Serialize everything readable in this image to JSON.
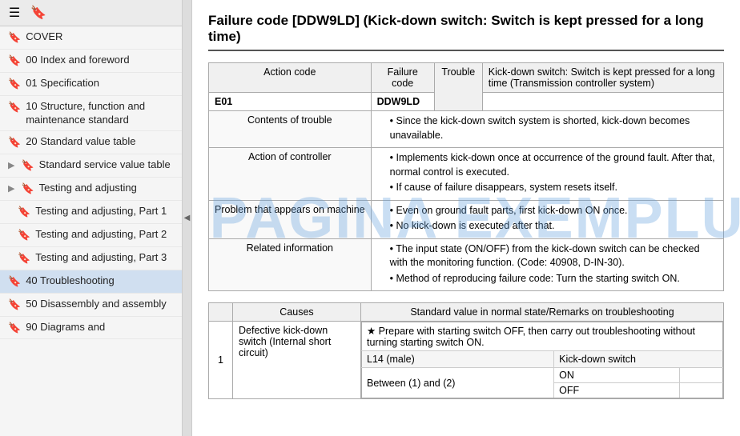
{
  "sidebar": {
    "toolbar": {
      "menu_icon": "☰",
      "bookmark_icon": "🔖"
    },
    "items": [
      {
        "id": "cover",
        "label": "COVER",
        "indent": false,
        "expandable": false,
        "active": false
      },
      {
        "id": "00-index",
        "label": "00 Index and foreword",
        "indent": false,
        "expandable": false,
        "active": false
      },
      {
        "id": "01-spec",
        "label": "01 Specification",
        "indent": false,
        "expandable": false,
        "active": false
      },
      {
        "id": "10-structure",
        "label": "10 Structure, function and maintenance standard",
        "indent": false,
        "expandable": false,
        "active": false
      },
      {
        "id": "20-standard",
        "label": "20 Standard value table",
        "indent": false,
        "expandable": false,
        "active": false
      },
      {
        "id": "standard-service",
        "label": "Standard service value table",
        "indent": false,
        "expandable": true,
        "active": false
      },
      {
        "id": "testing-adj",
        "label": "Testing and adjusting",
        "indent": false,
        "expandable": true,
        "active": false
      },
      {
        "id": "testing-adj-1",
        "label": "Testing and adjusting, Part 1",
        "indent": true,
        "expandable": false,
        "active": false
      },
      {
        "id": "testing-adj-2",
        "label": "Testing and adjusting, Part 2",
        "indent": true,
        "expandable": false,
        "active": false
      },
      {
        "id": "testing-adj-3",
        "label": "Testing and adjusting, Part 3",
        "indent": true,
        "expandable": false,
        "active": false
      },
      {
        "id": "40-troubleshooting",
        "label": "40 Troubleshooting",
        "indent": false,
        "expandable": false,
        "active": true
      },
      {
        "id": "50-disassembly",
        "label": "50 Disassembly and assembly",
        "indent": false,
        "expandable": false,
        "active": false
      },
      {
        "id": "90-diagrams",
        "label": "90 Diagrams and",
        "indent": false,
        "expandable": false,
        "active": false
      }
    ],
    "collapse_arrow": "◀"
  },
  "main": {
    "title": "Failure code [DDW9LD] (Kick-down switch: Switch is kept pressed for a long time)",
    "top_table": {
      "col_action_code": "Action code",
      "col_failure_code": "Failure code",
      "col_trouble": "Trouble",
      "col_description": "Kick-down switch: Switch is kept pressed for a long time (Transmission controller system)",
      "action_code_value": "E01",
      "failure_code_value": "DDW9LD",
      "rows": [
        {
          "label": "Contents of trouble",
          "content": "Since the kick-down switch system is shorted, kick-down becomes unavailable."
        },
        {
          "label": "Action of controller",
          "content_list": [
            "Implements kick-down once at occurrence of the ground fault. After that, normal control is executed.",
            "If cause of failure disappears, system resets itself."
          ]
        },
        {
          "label": "Problem that appears on machine",
          "content_list": [
            "Even on ground fault parts, first kick-down ON once.",
            "No kick-down is executed after that."
          ]
        },
        {
          "label": "Related information",
          "content_list": [
            "The input state (ON/OFF) from the kick-down switch can be checked with the monitoring function. (Code: 40908, D-IN-30).",
            "Method of reproducing failure code: Turn the starting switch ON."
          ]
        }
      ]
    },
    "causes_table": {
      "col_no": "",
      "col_causes": "Causes",
      "col_standard": "Standard value in normal state/Remarks on troubleshooting",
      "rows": [
        {
          "no": "1",
          "cause": "Defective kick-down switch (Internal short circuit)",
          "sub_rows": [
            {
              "condition": "L14 (male)",
              "value_label": "Kick-down switch",
              "on_label": "ON",
              "off_label": "OFF"
            },
            {
              "condition": "Between (1) and (2)",
              "on_value": "ON",
              "off_value": "OFF"
            }
          ]
        }
      ]
    }
  },
  "watermark": {
    "text": "PAGINA EXEMPLU"
  }
}
